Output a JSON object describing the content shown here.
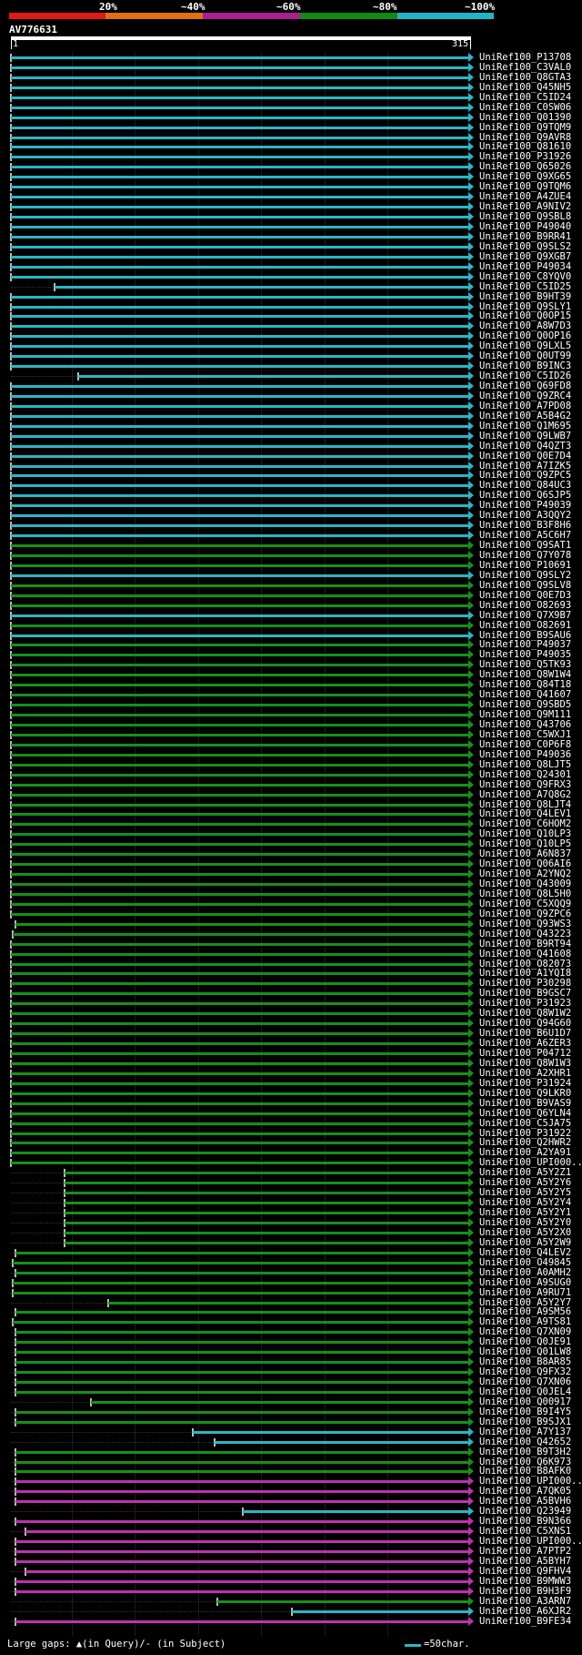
{
  "header": {
    "percent_labels": [
      "20%",
      "~40%",
      "~60%",
      "~80%",
      "~100%"
    ],
    "color_scale": [
      "#e01818",
      "#e07010",
      "#a82090",
      "#108a10",
      "#20b4c8"
    ],
    "query_id": "AV776631",
    "ruler_start": "1",
    "ruler_end": "315"
  },
  "hits": [
    {
      "label": "UniRef100_P13708",
      "start": 1,
      "end": 315,
      "color": "#2ab6c6"
    },
    {
      "label": "UniRef100_C3VAL0",
      "start": 1,
      "end": 315,
      "color": "#2ab6c6"
    },
    {
      "label": "UniRef100_Q8GTA3",
      "start": 1,
      "end": 315,
      "color": "#2ab6c6"
    },
    {
      "label": "UniRef100_Q45NH5",
      "start": 1,
      "end": 315,
      "color": "#2ab6c6"
    },
    {
      "label": "UniRef100_C5ID24",
      "start": 1,
      "end": 315,
      "color": "#2ab6c6"
    },
    {
      "label": "UniRef100_C0SW06",
      "start": 1,
      "end": 315,
      "color": "#2ab6c6"
    },
    {
      "label": "UniRef100_Q01390",
      "start": 1,
      "end": 315,
      "color": "#2ab6c6"
    },
    {
      "label": "UniRef100_Q9TQM9",
      "start": 1,
      "end": 315,
      "color": "#2ab6c6"
    },
    {
      "label": "UniRef100_Q9AVR8",
      "start": 1,
      "end": 315,
      "color": "#2ab6c6"
    },
    {
      "label": "UniRef100_Q81610",
      "start": 1,
      "end": 315,
      "color": "#2ab6c6"
    },
    {
      "label": "UniRef100_P31926",
      "start": 1,
      "end": 315,
      "color": "#2ab6c6"
    },
    {
      "label": "UniRef100_Q65026",
      "start": 1,
      "end": 315,
      "color": "#2ab6c6"
    },
    {
      "label": "UniRef100_Q9XG65",
      "start": 1,
      "end": 315,
      "color": "#2ab6c6"
    },
    {
      "label": "UniRef100_Q9TQM6",
      "start": 1,
      "end": 315,
      "color": "#2ab6c6"
    },
    {
      "label": "UniRef100_A4ZUE4",
      "start": 1,
      "end": 315,
      "color": "#2ab6c6"
    },
    {
      "label": "UniRef100_A9NIV2",
      "start": 1,
      "end": 315,
      "color": "#2ab6c6"
    },
    {
      "label": "UniRef100_Q9SBL8",
      "start": 1,
      "end": 315,
      "color": "#2ab6c6"
    },
    {
      "label": "UniRef100_P49040",
      "start": 1,
      "end": 315,
      "color": "#2ab6c6"
    },
    {
      "label": "UniRef100_B9RR41",
      "start": 1,
      "end": 315,
      "color": "#2ab6c6"
    },
    {
      "label": "UniRef100_Q9SLS2",
      "start": 1,
      "end": 315,
      "color": "#2ab6c6"
    },
    {
      "label": "UniRef100_Q9XGB7",
      "start": 1,
      "end": 315,
      "color": "#2ab6c6"
    },
    {
      "label": "UniRef100_P49034",
      "start": 1,
      "end": 315,
      "color": "#2ab6c6"
    },
    {
      "label": "UniRef100_C8YQV0",
      "start": 1,
      "end": 315,
      "color": "#2ab6c6"
    },
    {
      "label": "UniRef100_C5ID25",
      "start": 31,
      "end": 315,
      "color": "#2ab6c6"
    },
    {
      "label": "UniRef100_B9HT39",
      "start": 1,
      "end": 315,
      "color": "#2ab6c6"
    },
    {
      "label": "UniRef100_Q9SLY1",
      "start": 1,
      "end": 315,
      "color": "#2ab6c6"
    },
    {
      "label": "UniRef100_Q0OP15",
      "start": 1,
      "end": 315,
      "color": "#2ab6c6"
    },
    {
      "label": "UniRef100_A8W7D3",
      "start": 1,
      "end": 315,
      "color": "#2ab6c6"
    },
    {
      "label": "UniRef100_Q0OP16",
      "start": 1,
      "end": 315,
      "color": "#2ab6c6"
    },
    {
      "label": "UniRef100_Q9LXL5",
      "start": 1,
      "end": 315,
      "color": "#2ab6c6"
    },
    {
      "label": "UniRef100_Q0UT99",
      "start": 1,
      "end": 315,
      "color": "#2ab6c6"
    },
    {
      "label": "UniRef100_B9INC3",
      "start": 1,
      "end": 315,
      "color": "#2ab6c6"
    },
    {
      "label": "UniRef100_C5ID26",
      "start": 47,
      "end": 315,
      "color": "#2ab6c6"
    },
    {
      "label": "UniRef100_Q69FD8",
      "start": 1,
      "end": 315,
      "color": "#2ab6c6"
    },
    {
      "label": "UniRef100_Q9ZRC4",
      "start": 1,
      "end": 315,
      "color": "#2ab6c6"
    },
    {
      "label": "UniRef100_A7PD08",
      "start": 1,
      "end": 315,
      "color": "#2ab6c6"
    },
    {
      "label": "UniRef100_A5B4G2",
      "start": 1,
      "end": 315,
      "color": "#2ab6c6"
    },
    {
      "label": "UniRef100_Q1M695",
      "start": 1,
      "end": 315,
      "color": "#2ab6c6"
    },
    {
      "label": "UniRef100_Q9LWB7",
      "start": 1,
      "end": 315,
      "color": "#2ab6c6"
    },
    {
      "label": "UniRef100_Q4QZT3",
      "start": 1,
      "end": 315,
      "color": "#2ab6c6"
    },
    {
      "label": "UniRef100_Q0E7D4",
      "start": 1,
      "end": 315,
      "color": "#2ab6c6"
    },
    {
      "label": "UniRef100_A7IZK5",
      "start": 1,
      "end": 315,
      "color": "#2ab6c6"
    },
    {
      "label": "UniRef100_Q9ZPC5",
      "start": 1,
      "end": 315,
      "color": "#2ab6c6"
    },
    {
      "label": "UniRef100_Q84UC3",
      "start": 1,
      "end": 315,
      "color": "#2ab6c6"
    },
    {
      "label": "UniRef100_Q6SJP5",
      "start": 1,
      "end": 315,
      "color": "#2ab6c6"
    },
    {
      "label": "UniRef100_P49039",
      "start": 1,
      "end": 315,
      "color": "#2ab6c6"
    },
    {
      "label": "UniRef100_A3QQY2",
      "start": 1,
      "end": 315,
      "color": "#2ab6c6"
    },
    {
      "label": "UniRef100_B3F8H6",
      "start": 1,
      "end": 315,
      "color": "#2ab6c6"
    },
    {
      "label": "UniRef100_A5C6H7",
      "start": 1,
      "end": 315,
      "color": "#2ab6c6"
    },
    {
      "label": "UniRef100_Q9SAT1",
      "start": 1,
      "end": 315,
      "color": "#17901a"
    },
    {
      "label": "UniRef100_Q7Y078",
      "start": 1,
      "end": 315,
      "color": "#17901a"
    },
    {
      "label": "UniRef100_P10691",
      "start": 1,
      "end": 315,
      "color": "#17901a"
    },
    {
      "label": "UniRef100_Q9SLY2",
      "start": 1,
      "end": 315,
      "color": "#2ab6c6"
    },
    {
      "label": "UniRef100_Q9SLV8",
      "start": 1,
      "end": 315,
      "color": "#17901a"
    },
    {
      "label": "UniRef100_Q0E7D3",
      "start": 1,
      "end": 315,
      "color": "#17901a"
    },
    {
      "label": "UniRef100_O82693",
      "start": 1,
      "end": 315,
      "color": "#17901a"
    },
    {
      "label": "UniRef100_Q7X9B7",
      "start": 1,
      "end": 315,
      "color": "#2ab6c6"
    },
    {
      "label": "UniRef100_O82691",
      "start": 1,
      "end": 315,
      "color": "#17901a"
    },
    {
      "label": "UniRef100_B9SAU6",
      "start": 1,
      "end": 315,
      "color": "#2ab6c6"
    },
    {
      "label": "UniRef100_P49037",
      "start": 1,
      "end": 315,
      "color": "#17901a"
    },
    {
      "label": "UniRef100_P49035",
      "start": 1,
      "end": 315,
      "color": "#17901a"
    },
    {
      "label": "UniRef100_Q5TK93",
      "start": 1,
      "end": 315,
      "color": "#17901a"
    },
    {
      "label": "UniRef100_Q8W1W4",
      "start": 1,
      "end": 315,
      "color": "#17901a"
    },
    {
      "label": "UniRef100_Q84T18",
      "start": 1,
      "end": 315,
      "color": "#17901a"
    },
    {
      "label": "UniRef100_Q41607",
      "start": 1,
      "end": 315,
      "color": "#17901a"
    },
    {
      "label": "UniRef100_Q9SBD5",
      "start": 1,
      "end": 315,
      "color": "#17901a"
    },
    {
      "label": "UniRef100_Q9M111",
      "start": 1,
      "end": 315,
      "color": "#17901a"
    },
    {
      "label": "UniRef100_Q43706",
      "start": 1,
      "end": 315,
      "color": "#17901a"
    },
    {
      "label": "UniRef100_C5WXJ1",
      "start": 1,
      "end": 315,
      "color": "#17901a"
    },
    {
      "label": "UniRef100_C0P6F8",
      "start": 1,
      "end": 315,
      "color": "#17901a"
    },
    {
      "label": "UniRef100_P49036",
      "start": 1,
      "end": 315,
      "color": "#17901a"
    },
    {
      "label": "UniRef100_Q8LJT5",
      "start": 1,
      "end": 315,
      "color": "#17901a"
    },
    {
      "label": "UniRef100_Q24301",
      "start": 1,
      "end": 315,
      "color": "#17901a"
    },
    {
      "label": "UniRef100_Q9FRX3",
      "start": 1,
      "end": 315,
      "color": "#17901a"
    },
    {
      "label": "UniRef100_A7Q8G2",
      "start": 1,
      "end": 315,
      "color": "#17901a"
    },
    {
      "label": "UniRef100_Q8LJT4",
      "start": 1,
      "end": 315,
      "color": "#17901a"
    },
    {
      "label": "UniRef100_Q4LEV1",
      "start": 1,
      "end": 315,
      "color": "#17901a"
    },
    {
      "label": "UniRef100_C6HOM2",
      "start": 1,
      "end": 315,
      "color": "#17901a"
    },
    {
      "label": "UniRef100_Q10LP3",
      "start": 1,
      "end": 315,
      "color": "#17901a"
    },
    {
      "label": "UniRef100_Q10LP5",
      "start": 1,
      "end": 315,
      "color": "#17901a"
    },
    {
      "label": "UniRef100_A6N837",
      "start": 1,
      "end": 315,
      "color": "#17901a"
    },
    {
      "label": "UniRef100_Q06AI6",
      "start": 1,
      "end": 315,
      "color": "#17901a"
    },
    {
      "label": "UniRef100_A2YNQ2",
      "start": 1,
      "end": 315,
      "color": "#17901a"
    },
    {
      "label": "UniRef100_Q43009",
      "start": 1,
      "end": 315,
      "color": "#17901a"
    },
    {
      "label": "UniRef100_Q8L5H0",
      "start": 1,
      "end": 315,
      "color": "#17901a"
    },
    {
      "label": "UniRef100_C5XQQ9",
      "start": 1,
      "end": 315,
      "color": "#17901a"
    },
    {
      "label": "UniRef100_Q9ZPC6",
      "start": 1,
      "end": 315,
      "color": "#17901a"
    },
    {
      "label": "UniRef100_Q93WS3",
      "start": 4,
      "end": 315,
      "color": "#17901a"
    },
    {
      "label": "UniRef100_Q43223",
      "start": 2,
      "end": 315,
      "color": "#17901a"
    },
    {
      "label": "UniRef100_B9RT94",
      "start": 1,
      "end": 315,
      "color": "#17901a"
    },
    {
      "label": "UniRef100_Q41608",
      "start": 1,
      "end": 315,
      "color": "#17901a"
    },
    {
      "label": "UniRef100_O82073",
      "start": 1,
      "end": 315,
      "color": "#17901a"
    },
    {
      "label": "UniRef100_A1YQI8",
      "start": 1,
      "end": 315,
      "color": "#17901a"
    },
    {
      "label": "UniRef100_P30298",
      "start": 1,
      "end": 315,
      "color": "#17901a"
    },
    {
      "label": "UniRef100_B9GSC7",
      "start": 1,
      "end": 315,
      "color": "#17901a"
    },
    {
      "label": "UniRef100_P31923",
      "start": 1,
      "end": 315,
      "color": "#17901a"
    },
    {
      "label": "UniRef100_Q8W1W2",
      "start": 1,
      "end": 315,
      "color": "#17901a"
    },
    {
      "label": "UniRef100_Q94G60",
      "start": 1,
      "end": 315,
      "color": "#17901a"
    },
    {
      "label": "UniRef100_B6U1D7",
      "start": 1,
      "end": 315,
      "color": "#17901a"
    },
    {
      "label": "UniRef100_A6ZER3",
      "start": 1,
      "end": 315,
      "color": "#17901a"
    },
    {
      "label": "UniRef100_P04712",
      "start": 1,
      "end": 315,
      "color": "#17901a"
    },
    {
      "label": "UniRef100_Q8W1W3",
      "start": 1,
      "end": 315,
      "color": "#17901a"
    },
    {
      "label": "UniRef100_A2XHR1",
      "start": 1,
      "end": 315,
      "color": "#17901a"
    },
    {
      "label": "UniRef100_P31924",
      "start": 1,
      "end": 315,
      "color": "#17901a"
    },
    {
      "label": "UniRef100_Q9LKR0",
      "start": 1,
      "end": 315,
      "color": "#17901a"
    },
    {
      "label": "UniRef100_B9VAS9",
      "start": 1,
      "end": 315,
      "color": "#17901a"
    },
    {
      "label": "UniRef100_Q6YLN4",
      "start": 1,
      "end": 315,
      "color": "#17901a"
    },
    {
      "label": "UniRef100_C5JA75",
      "start": 1,
      "end": 315,
      "color": "#17901a"
    },
    {
      "label": "UniRef100_P31922",
      "start": 1,
      "end": 315,
      "color": "#17901a"
    },
    {
      "label": "UniRef100_Q2HWR2",
      "start": 1,
      "end": 315,
      "color": "#17901a"
    },
    {
      "label": "UniRef100_A2YA91",
      "start": 1,
      "end": 315,
      "color": "#17901a"
    },
    {
      "label": "UniRef100_UPI000...",
      "start": 1,
      "end": 315,
      "color": "#17901a"
    },
    {
      "label": "UniRef100_A5Y2Z1",
      "start": 38,
      "end": 315,
      "color": "#17901a"
    },
    {
      "label": "UniRef100_A5Y2Y6",
      "start": 38,
      "end": 315,
      "color": "#17901a"
    },
    {
      "label": "UniRef100_A5Y2Y5",
      "start": 38,
      "end": 315,
      "color": "#17901a"
    },
    {
      "label": "UniRef100_A5Y2Y4",
      "start": 38,
      "end": 315,
      "color": "#17901a"
    },
    {
      "label": "UniRef100_A5Y2Y1",
      "start": 38,
      "end": 315,
      "color": "#17901a"
    },
    {
      "label": "UniRef100_A5Y2Y0",
      "start": 38,
      "end": 315,
      "color": "#17901a"
    },
    {
      "label": "UniRef100_A5Y2X0",
      "start": 38,
      "end": 315,
      "color": "#17901a"
    },
    {
      "label": "UniRef100_A5Y2W9",
      "start": 38,
      "end": 315,
      "color": "#17901a"
    },
    {
      "label": "UniRef100_Q4LEV2",
      "start": 4,
      "end": 315,
      "color": "#17901a"
    },
    {
      "label": "UniRef100_O49845",
      "start": 2,
      "end": 315,
      "color": "#17901a"
    },
    {
      "label": "UniRef100_A0AMH2",
      "start": 4,
      "end": 315,
      "color": "#17901a"
    },
    {
      "label": "UniRef100_A9SUG0",
      "start": 2,
      "end": 315,
      "color": "#17901a"
    },
    {
      "label": "UniRef100_A9RU71",
      "start": 2,
      "end": 315,
      "color": "#17901a"
    },
    {
      "label": "UniRef100_A5Y2Y7",
      "start": 68,
      "end": 315,
      "color": "#17901a"
    },
    {
      "label": "UniRef100_A9SM56",
      "start": 4,
      "end": 315,
      "color": "#17901a"
    },
    {
      "label": "UniRef100_A9TS81",
      "start": 2,
      "end": 315,
      "color": "#17901a"
    },
    {
      "label": "UniRef100_Q7XN09",
      "start": 4,
      "end": 315,
      "color": "#17901a"
    },
    {
      "label": "UniRef100_Q0JE91",
      "start": 4,
      "end": 315,
      "color": "#17901a"
    },
    {
      "label": "UniRef100_Q01LW8",
      "start": 4,
      "end": 315,
      "color": "#17901a"
    },
    {
      "label": "UniRef100_B8AR85",
      "start": 4,
      "end": 315,
      "color": "#17901a"
    },
    {
      "label": "UniRef100_Q9FX32",
      "start": 4,
      "end": 315,
      "color": "#17901a"
    },
    {
      "label": "UniRef100_Q7XN06",
      "start": 4,
      "end": 315,
      "color": "#17901a"
    },
    {
      "label": "UniRef100_Q0JEL4",
      "start": 4,
      "end": 315,
      "color": "#17901a"
    },
    {
      "label": "UniRef100_Q00917",
      "start": 56,
      "end": 315,
      "color": "#17901a"
    },
    {
      "label": "UniRef100_B9I4Y5",
      "start": 4,
      "end": 315,
      "color": "#17901a"
    },
    {
      "label": "UniRef100_B9SJX1",
      "start": 4,
      "end": 315,
      "color": "#17901a"
    },
    {
      "label": "UniRef100_A7Y137",
      "start": 126,
      "end": 315,
      "color": "#2ab6c6"
    },
    {
      "label": "UniRef100_Q42652",
      "start": 141,
      "end": 315,
      "color": "#2ab6c6"
    },
    {
      "label": "UniRef100_B9T3H2",
      "start": 4,
      "end": 315,
      "color": "#17901a"
    },
    {
      "label": "UniRef100_Q6K973",
      "start": 4,
      "end": 315,
      "color": "#17901a"
    },
    {
      "label": "UniRef100_B8AFK0",
      "start": 4,
      "end": 315,
      "color": "#17901a"
    },
    {
      "label": "UniRef100_UPI000...",
      "start": 4,
      "end": 315,
      "color": "#c030b0"
    },
    {
      "label": "UniRef100_A7QK05",
      "start": 4,
      "end": 315,
      "color": "#c030b0"
    },
    {
      "label": "UniRef100_A5BVH6",
      "start": 4,
      "end": 315,
      "color": "#c030b0"
    },
    {
      "label": "UniRef100_Q23949",
      "start": 160,
      "end": 315,
      "color": "#2ab6c6"
    },
    {
      "label": "UniRef100_B9N366",
      "start": 4,
      "end": 315,
      "color": "#c030b0"
    },
    {
      "label": "UniRef100_C5XNS1",
      "start": 11,
      "end": 315,
      "color": "#c030b0"
    },
    {
      "label": "UniRef100_UPI000...",
      "start": 4,
      "end": 315,
      "color": "#c030b0"
    },
    {
      "label": "UniRef100_A7PTP2",
      "start": 4,
      "end": 315,
      "color": "#c030b0"
    },
    {
      "label": "UniRef100_A5BYH7",
      "start": 4,
      "end": 315,
      "color": "#c030b0"
    },
    {
      "label": "UniRef100_Q9FHV4",
      "start": 11,
      "end": 315,
      "color": "#c030b0"
    },
    {
      "label": "UniRef100_B9MWW3",
      "start": 4,
      "end": 315,
      "color": "#c030b0"
    },
    {
      "label": "UniRef100_B9H3F9",
      "start": 4,
      "end": 315,
      "color": "#c030b0"
    },
    {
      "label": "UniRef100_A3ARN7",
      "start": 143,
      "end": 315,
      "color": "#17901a"
    },
    {
      "label": "UniRef100_A6XJR2",
      "start": 194,
      "end": 315,
      "color": "#2ab6c6"
    },
    {
      "label": "UniRef100_B9FE34",
      "start": 4,
      "end": 315,
      "color": "#c030b0"
    }
  ],
  "footer": {
    "legend": "Large gaps: ▲(in Query)/- (in Subject)",
    "scale": "=50char."
  }
}
